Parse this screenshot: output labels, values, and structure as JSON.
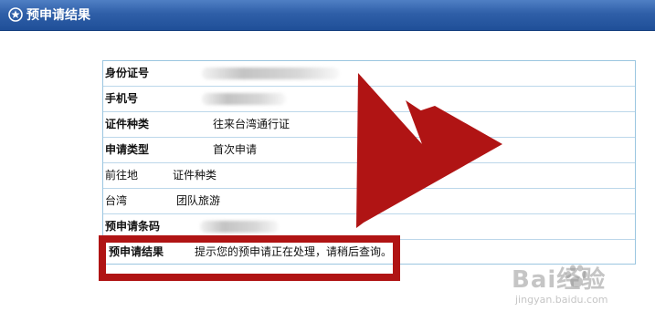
{
  "window": {
    "title": "预申请结果",
    "icon": "star-circle-icon",
    "accent_color": "#2f5fa8"
  },
  "form": {
    "rows": [
      {
        "label": "身份证号",
        "value": "",
        "bold": true,
        "redacted": true
      },
      {
        "label": "手机号",
        "value": "",
        "bold": true,
        "redacted": true
      },
      {
        "label": "证件种类",
        "value": "往来台湾通行证",
        "bold": true
      },
      {
        "label": "申请类型",
        "value": "首次申请",
        "bold": true
      },
      {
        "label": "前往地",
        "value": "证件种类",
        "bold": false
      },
      {
        "label": "台湾",
        "value": "团队旅游",
        "bold": false
      },
      {
        "label": "预申请条码",
        "value": "",
        "bold": true,
        "redacted": true
      },
      {
        "label": "预申请结果",
        "value": "提示您的预申请正在处理，请稍后查询。",
        "bold": true
      }
    ]
  },
  "annotation": {
    "highlight_color": "#b01414",
    "arrow_color": "#b01414"
  },
  "watermark": {
    "brand": "Bai经验",
    "url": "jingyan.baidu.com"
  }
}
